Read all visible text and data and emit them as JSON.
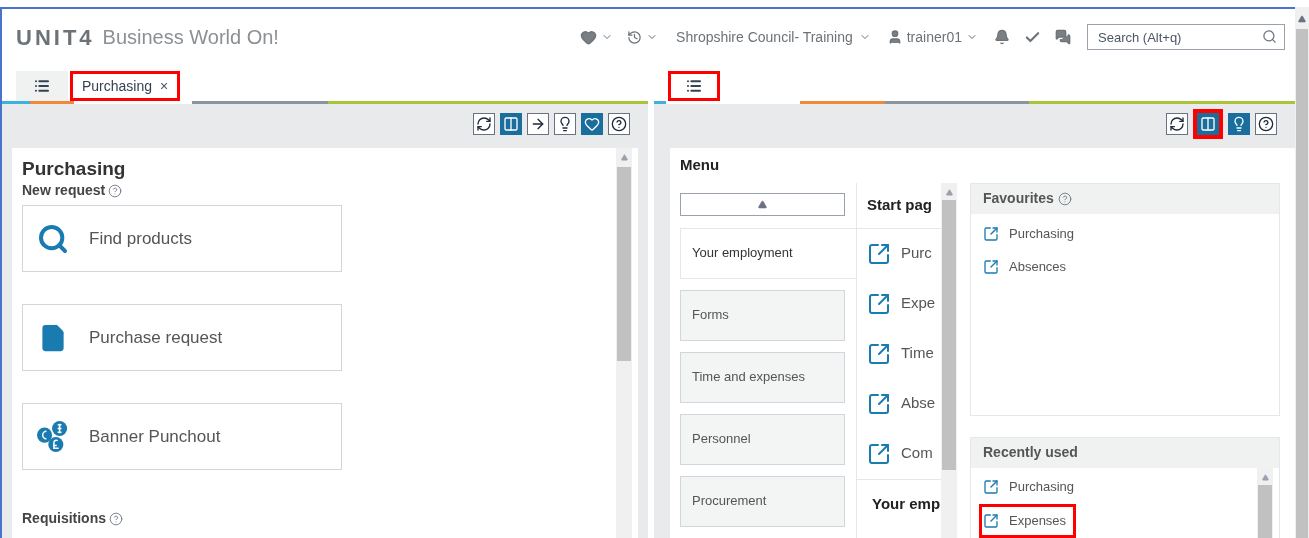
{
  "header": {
    "brand": "UNIT4",
    "product": "Business World On!",
    "company": "Shropshire Council- Training",
    "user": "trainer01",
    "search": {
      "placeholder": "Search (Alt+q)"
    }
  },
  "left_pane": {
    "tabs": [
      {
        "kind": "menu",
        "selected": false,
        "highlighted": false
      },
      {
        "kind": "page",
        "label": "Purchasing",
        "close": "×",
        "selected": true,
        "highlighted": true
      }
    ],
    "toolbar": [
      {
        "selected": false,
        "highlighted": false
      },
      {
        "selected": true,
        "highlighted": false
      },
      {
        "selected": false,
        "highlighted": false
      },
      {
        "selected": false,
        "highlighted": false
      },
      {
        "selected": true,
        "highlighted": false
      },
      {
        "selected": false,
        "highlighted": false
      }
    ],
    "title": "Purchasing",
    "section": "New request",
    "tiles": [
      {
        "label": "Find products"
      },
      {
        "label": "Purchase request"
      },
      {
        "label": "Banner Punchout"
      }
    ],
    "section_2": "Requisitions"
  },
  "right_pane": {
    "tabs": [
      {
        "kind": "menu",
        "selected": true,
        "highlighted": true
      }
    ],
    "toolbar": [
      {
        "selected": false,
        "highlighted": false
      },
      {
        "selected": true,
        "highlighted": true
      },
      {
        "selected": true,
        "highlighted": false
      },
      {
        "selected": false,
        "highlighted": false
      }
    ],
    "menu_title": "Menu",
    "menu_items": [
      {
        "label": "Your employment",
        "selected": true
      },
      {
        "label": "Forms",
        "selected": false
      },
      {
        "label": "Time and expenses",
        "selected": false
      },
      {
        "label": "Personnel",
        "selected": false
      },
      {
        "label": "Procurement",
        "selected": false
      }
    ],
    "start_page": {
      "title": "Start pag",
      "links": [
        "Purc",
        "Expe",
        "Time",
        "Abse",
        "Com"
      ],
      "section": "Your emp"
    },
    "favourites": {
      "title": "Favourites",
      "links": [
        {
          "label": "Purchasing",
          "highlighted": false
        },
        {
          "label": "Absences",
          "highlighted": false
        }
      ]
    },
    "recently_used": {
      "title": "Recently used",
      "links": [
        {
          "label": "Purchasing",
          "highlighted": false
        },
        {
          "label": "Expenses",
          "highlighted": true
        }
      ]
    }
  }
}
